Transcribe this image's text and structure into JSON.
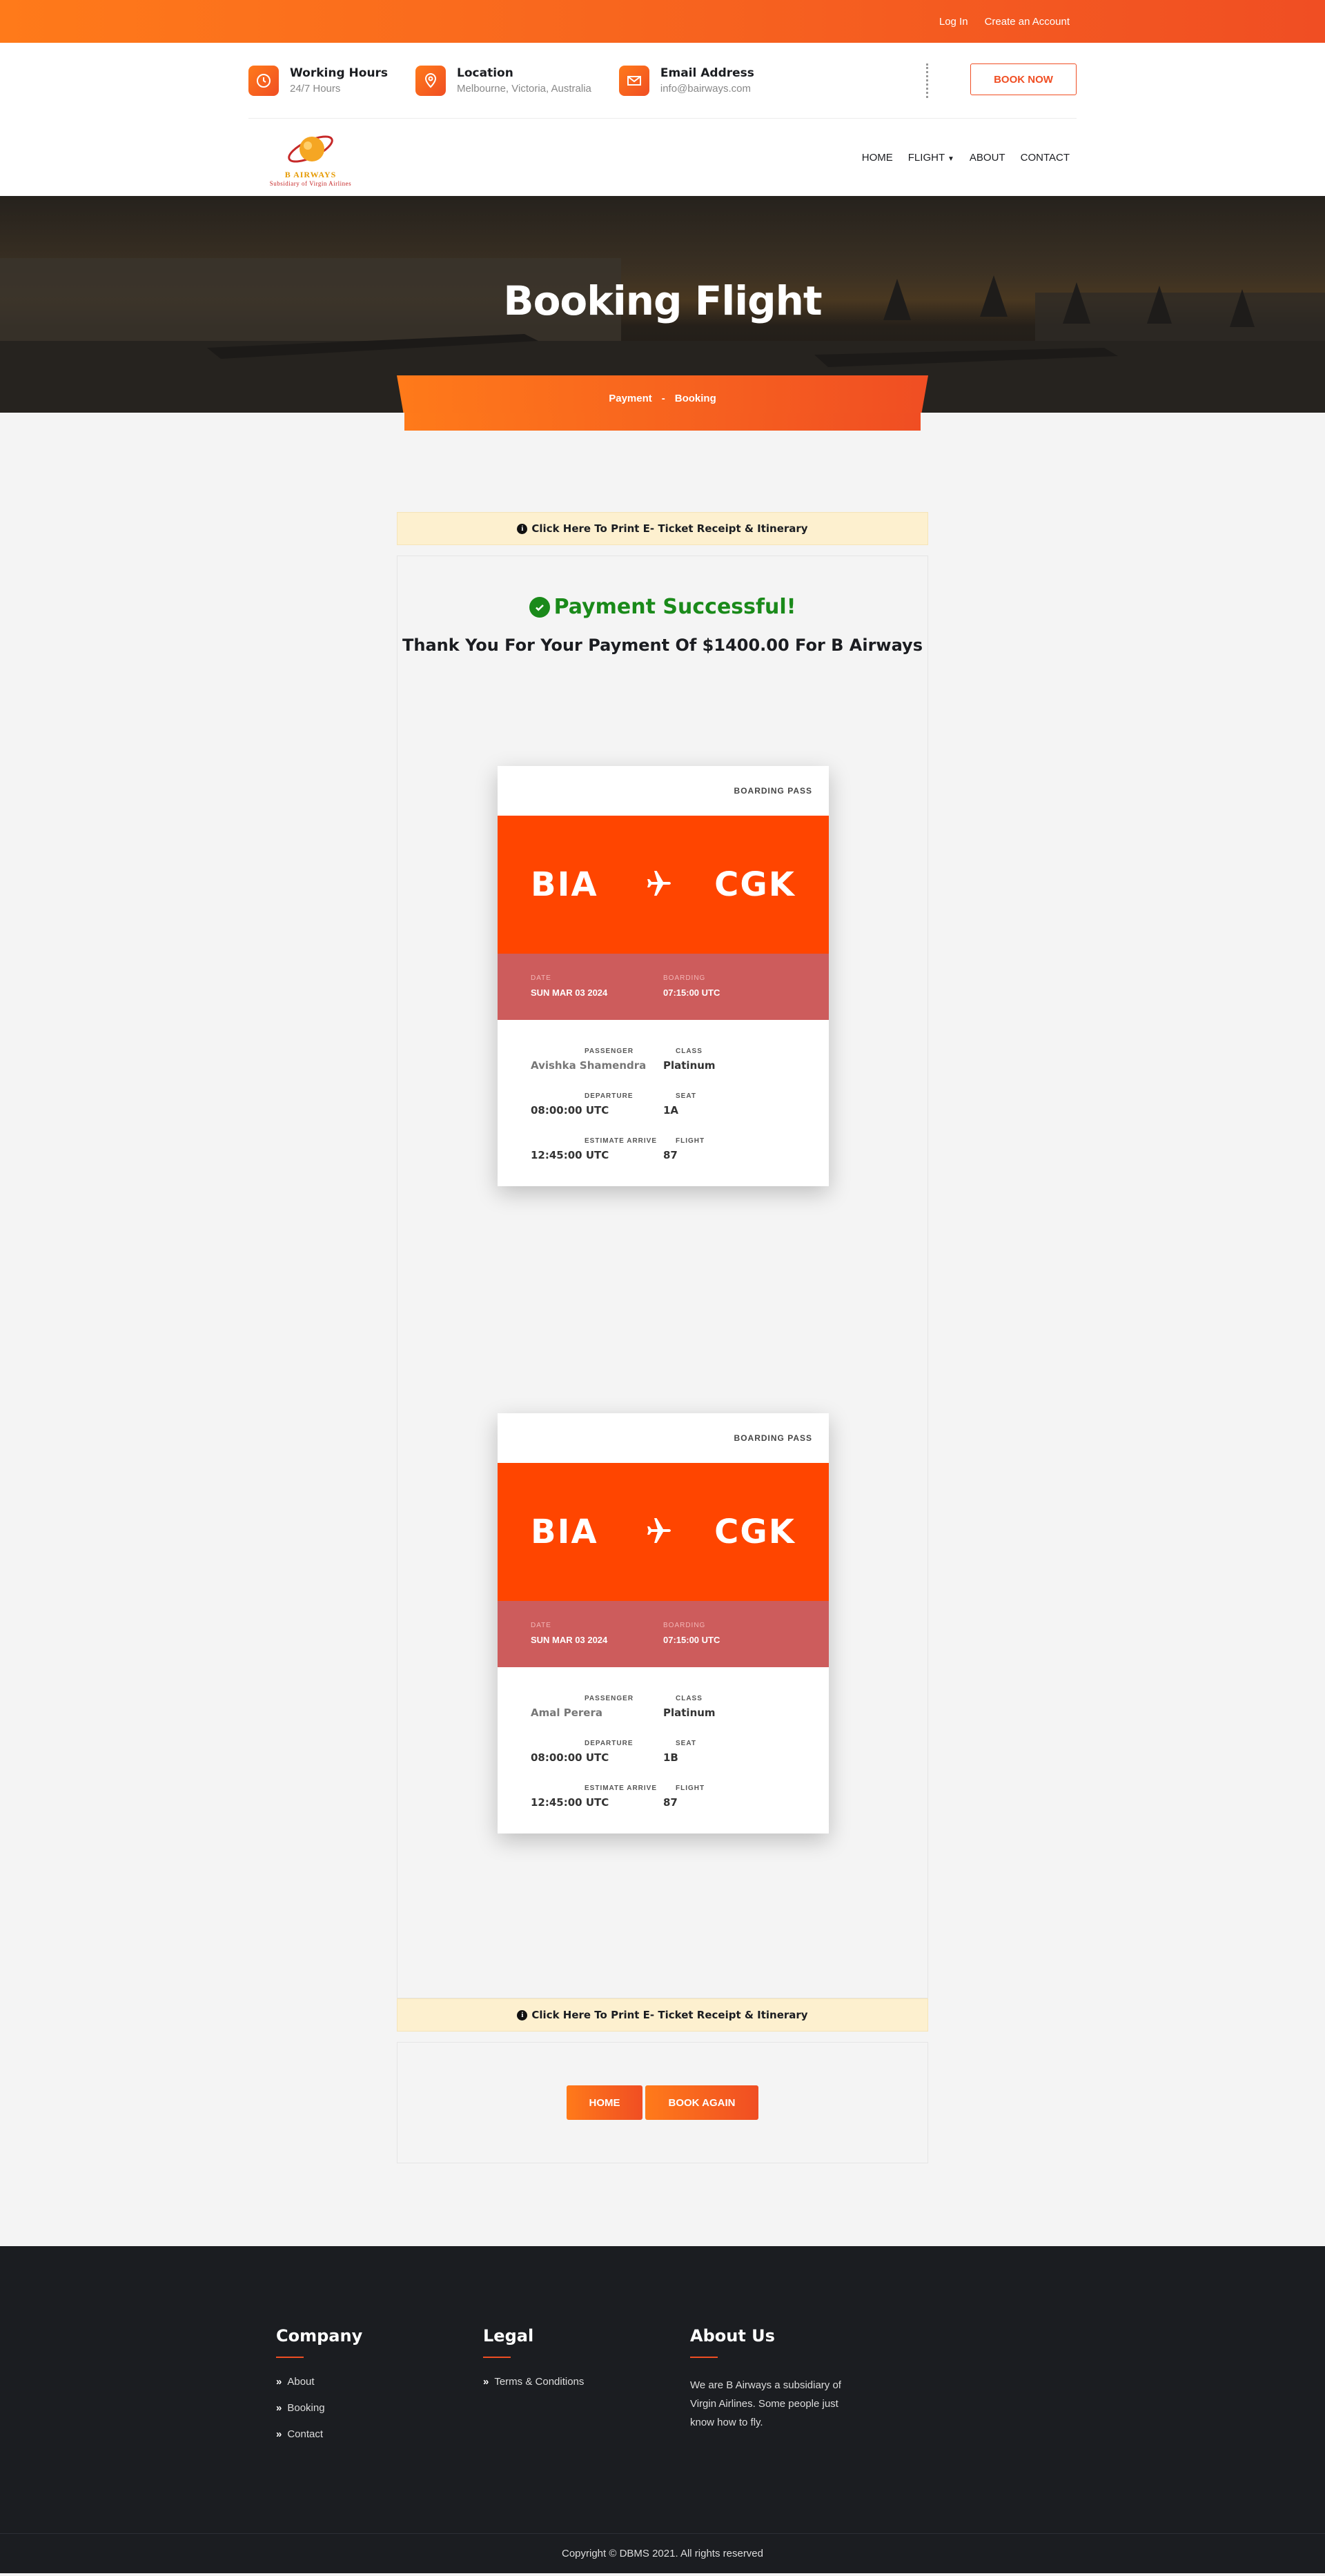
{
  "topbar": {
    "login": "Log In",
    "create_account": "Create an Account"
  },
  "header": {
    "working_hours": {
      "title": "Working Hours",
      "value": "24/7 Hours"
    },
    "location": {
      "title": "Location",
      "value": "Melbourne, Victoria, Australia"
    },
    "email": {
      "title": "Email Address",
      "value": "info@bairways.com"
    },
    "book_now": "BOOK NOW"
  },
  "logo": {
    "brand": "B AIRWAYS",
    "tagline": "Subsidiary of Virgin Airlines"
  },
  "nav": {
    "home": "HOME",
    "flight": "FLIGHT",
    "about": "ABOUT",
    "contact": "CONTACT"
  },
  "hero": {
    "title": "Booking Flight",
    "crumb_1": "Payment",
    "crumb_sep": "-",
    "crumb_2": "Booking"
  },
  "print_link": "Click Here To Print E- Ticket Receipt & Itinerary",
  "result": {
    "status": "Payment Successful!",
    "message": "Thank You For Your Payment Of $1400.00 For B Airways"
  },
  "passes": [
    {
      "header": "BOARDING PASS",
      "from": "BIA",
      "to": "CGK",
      "date_label": "DATE",
      "date": "SUN MAR 03 2024",
      "boarding_label": "BOARDING",
      "boarding": "07:15:00 UTC",
      "passenger_label": "PASSENGER",
      "passenger": "Avishka Shamendra",
      "class_label": "CLASS",
      "class": "Platinum",
      "departure_label": "DEPARTURE",
      "departure": "08:00:00 UTC",
      "seat_label": "SEAT",
      "seat": "1A",
      "arrive_label": "ESTIMATE ARRIVE",
      "arrive": "12:45:00 UTC",
      "flight_label": "FLIGHT",
      "flight": "87"
    },
    {
      "header": "BOARDING PASS",
      "from": "BIA",
      "to": "CGK",
      "date_label": "DATE",
      "date": "SUN MAR 03 2024",
      "boarding_label": "BOARDING",
      "boarding": "07:15:00 UTC",
      "passenger_label": "PASSENGER",
      "passenger": "Amal Perera",
      "class_label": "CLASS",
      "class": "Platinum",
      "departure_label": "DEPARTURE",
      "departure": "08:00:00 UTC",
      "seat_label": "SEAT",
      "seat": "1B",
      "arrive_label": "ESTIMATE ARRIVE",
      "arrive": "12:45:00 UTC",
      "flight_label": "FLIGHT",
      "flight": "87"
    }
  ],
  "actions": {
    "home": "HOME",
    "book_again": "BOOK AGAIN"
  },
  "footer": {
    "company": {
      "title": "Company",
      "links": [
        "About",
        "Booking",
        "Contact"
      ]
    },
    "legal": {
      "title": "Legal",
      "links": [
        "Terms & Conditions"
      ]
    },
    "about": {
      "title": "About Us",
      "text": "We are B Airways a subsidiary of Virgin Airlines. Some people just know how to fly."
    },
    "copyright": "Copyright © DBMS 2021. All rights reserved"
  },
  "colors": {
    "accent": "#f04e23",
    "accent_light": "#ff7a1a",
    "pass_route": "#ff4500",
    "pass_strip": "#cd5c5c",
    "success": "#1a8a1a",
    "footer_bg": "#1b1d21"
  }
}
